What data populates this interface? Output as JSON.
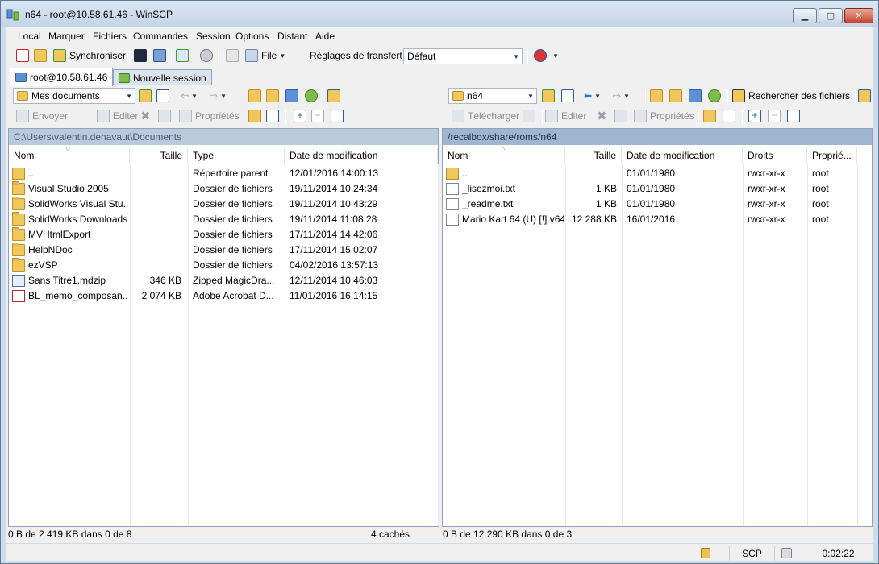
{
  "window": {
    "title": "n64 - root@10.58.61.46 - WinSCP"
  },
  "menu": [
    "Local",
    "Marquer",
    "Fichiers",
    "Commandes",
    "Session",
    "Options",
    "Distant",
    "Aide"
  ],
  "toolbar": {
    "sync_label": "Synchroniser",
    "file_label": "File",
    "transfer_label": "Réglages de transfert",
    "transfer_value": "Défaut"
  },
  "tabs": [
    {
      "label": "root@10.58.61.46"
    },
    {
      "label": "Nouvelle session"
    }
  ],
  "left": {
    "location": "Mes documents",
    "actions": {
      "send": "Envoyer",
      "edit": "Editer",
      "props": "Propriétés"
    },
    "path": "C:\\Users\\valentin.denavaut\\Documents",
    "columns": {
      "name": "Nom",
      "size": "Taille",
      "type": "Type",
      "date": "Date de modification"
    },
    "rows": [
      {
        "icon": "parent-folder-icon",
        "name": "..",
        "size": "",
        "type": "Répertoire parent",
        "date": "12/01/2016  14:00:13"
      },
      {
        "icon": "folder-icon",
        "name": "Visual Studio 2005",
        "size": "",
        "type": "Dossier de fichiers",
        "date": "19/11/2014  10:24:34"
      },
      {
        "icon": "folder-icon",
        "name": "SolidWorks Visual Stu...",
        "size": "",
        "type": "Dossier de fichiers",
        "date": "19/11/2014  10:43:29"
      },
      {
        "icon": "folder-icon",
        "name": "SolidWorks Downloads",
        "size": "",
        "type": "Dossier de fichiers",
        "date": "19/11/2014  11:08:28"
      },
      {
        "icon": "folder-icon",
        "name": "MVHtmlExport",
        "size": "",
        "type": "Dossier de fichiers",
        "date": "17/11/2014  14:42:06"
      },
      {
        "icon": "folder-icon",
        "name": "HelpNDoc",
        "size": "",
        "type": "Dossier de fichiers",
        "date": "17/11/2014  15:02:07"
      },
      {
        "icon": "folder-icon",
        "name": "ezVSP",
        "size": "",
        "type": "Dossier de fichiers",
        "date": "04/02/2016  13:57:13"
      },
      {
        "icon": "zip-icon",
        "name": "Sans Titre1.mdzip",
        "size": "346 KB",
        "type": "Zipped MagicDra...",
        "date": "12/11/2014  10:46:03"
      },
      {
        "icon": "pdf-icon",
        "name": "BL_memo_composan...",
        "size": "2 074 KB",
        "type": "Adobe Acrobat D...",
        "date": "11/01/2016  16:14:15"
      }
    ],
    "status": "0 B de 2 419 KB dans 0 de 8",
    "hidden": "4 cachés"
  },
  "right": {
    "location": "n64",
    "actions": {
      "download": "Télécharger",
      "edit": "Editer",
      "props": "Propriétés"
    },
    "search": "Rechercher des fichiers",
    "path": "/recalbox/share/roms/n64",
    "columns": {
      "name": "Nom",
      "size": "Taille",
      "date": "Date de modification",
      "rights": "Droits",
      "owner": "Proprié..."
    },
    "rows": [
      {
        "icon": "parent-folder-icon",
        "name": "..",
        "size": "",
        "date": "01/01/1980",
        "rights": "rwxr-xr-x",
        "owner": "root"
      },
      {
        "icon": "text-file-icon",
        "name": "_lisezmoi.txt",
        "size": "1 KB",
        "date": "01/01/1980",
        "rights": "rwxr-xr-x",
        "owner": "root"
      },
      {
        "icon": "text-file-icon",
        "name": "_readme.txt",
        "size": "1 KB",
        "date": "01/01/1980",
        "rights": "rwxr-xr-x",
        "owner": "root"
      },
      {
        "icon": "file-icon",
        "name": "Mario Kart 64 (U) [!].v64",
        "size": "12 288 KB",
        "date": "16/01/2016",
        "rights": "rwxr-xr-x",
        "owner": "root"
      }
    ],
    "status": "0 B de 12 290 KB dans 0 de 3"
  },
  "bottom": {
    "protocol": "SCP",
    "time": "0:02:22"
  }
}
